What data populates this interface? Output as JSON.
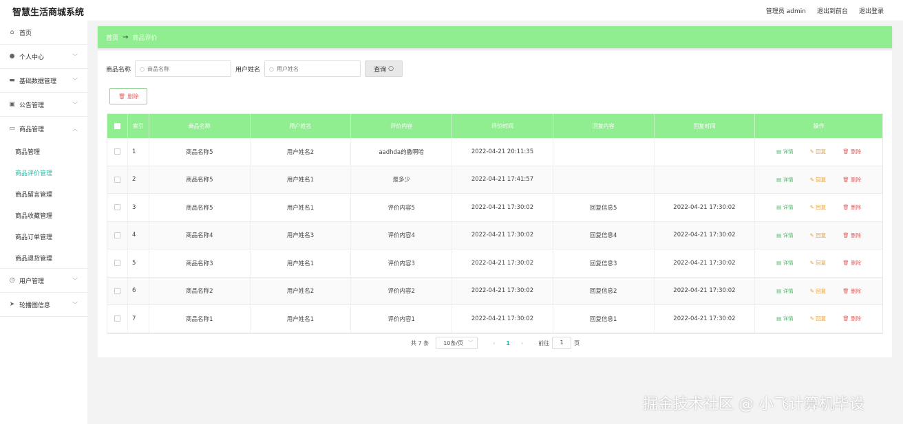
{
  "app": {
    "title": "智慧生活商城系统"
  },
  "header": {
    "admin_label": "管理员 admin",
    "front_label": "退出到前台",
    "logout_label": "退出登录"
  },
  "sidebar": {
    "items": [
      {
        "label": "首页",
        "icon": "home-icon"
      },
      {
        "label": "个人中心",
        "icon": "user-icon"
      },
      {
        "label": "基础数据管理",
        "icon": "briefcase-icon"
      },
      {
        "label": "公告管理",
        "icon": "clipboard-icon"
      },
      {
        "label": "商品管理",
        "icon": "chat-icon"
      },
      {
        "label": "用户管理",
        "icon": "clock-icon"
      },
      {
        "label": "轮播图信息",
        "icon": "send-icon"
      }
    ],
    "subitems": [
      "商品管理",
      "商品评价管理",
      "商品留言管理",
      "商品收藏管理",
      "商品订单管理",
      "商品退货管理"
    ]
  },
  "breadcrumb": {
    "home": "首页",
    "current": "商品评价"
  },
  "search": {
    "goods_label": "商品名称",
    "goods_placeholder": "商品名称",
    "user_label": "用户姓名",
    "user_placeholder": "用户姓名",
    "query_label": "查询"
  },
  "toolbar": {
    "delete_label": "删除"
  },
  "table": {
    "headers": [
      "索引",
      "商品名称",
      "用户姓名",
      "评价内容",
      "评价时间",
      "回复内容",
      "回复时间",
      "操作"
    ],
    "op_labels": {
      "detail": "详情",
      "reply": "回复",
      "delete": "删除"
    },
    "rows": [
      {
        "idx": "1",
        "goods": "商品名称5",
        "user": "用户姓名2",
        "content": "aadhda的撒啊哈",
        "time": "2022-04-21 20:11:35",
        "reply": "",
        "reply_time": ""
      },
      {
        "idx": "2",
        "goods": "商品名称5",
        "user": "用户姓名1",
        "content": "是多少",
        "time": "2022-04-21 17:41:57",
        "reply": "",
        "reply_time": ""
      },
      {
        "idx": "3",
        "goods": "商品名称5",
        "user": "用户姓名1",
        "content": "评价内容5",
        "time": "2022-04-21 17:30:02",
        "reply": "回复信息5",
        "reply_time": "2022-04-21 17:30:02"
      },
      {
        "idx": "4",
        "goods": "商品名称4",
        "user": "用户姓名3",
        "content": "评价内容4",
        "time": "2022-04-21 17:30:02",
        "reply": "回复信息4",
        "reply_time": "2022-04-21 17:30:02"
      },
      {
        "idx": "5",
        "goods": "商品名称3",
        "user": "用户姓名1",
        "content": "评价内容3",
        "time": "2022-04-21 17:30:02",
        "reply": "回复信息3",
        "reply_time": "2022-04-21 17:30:02"
      },
      {
        "idx": "6",
        "goods": "商品名称2",
        "user": "用户姓名2",
        "content": "评价内容2",
        "time": "2022-04-21 17:30:02",
        "reply": "回复信息2",
        "reply_time": "2022-04-21 17:30:02"
      },
      {
        "idx": "7",
        "goods": "商品名称1",
        "user": "用户姓名1",
        "content": "评价内容1",
        "time": "2022-04-21 17:30:02",
        "reply": "回复信息1",
        "reply_time": "2022-04-21 17:30:02"
      }
    ]
  },
  "pagination": {
    "total": "共 7 条",
    "page_size": "10条/页",
    "current": "1",
    "goto_label": "前往",
    "goto_value": "1",
    "page_suffix": "页"
  },
  "watermark": "掘金技术社区 @ 小飞计算机毕设",
  "colors": {
    "accent": "#90ee90",
    "active_text": "#2db7a3",
    "detail": "#52b56b",
    "reply": "#e6a23c",
    "delete": "#e06666"
  }
}
